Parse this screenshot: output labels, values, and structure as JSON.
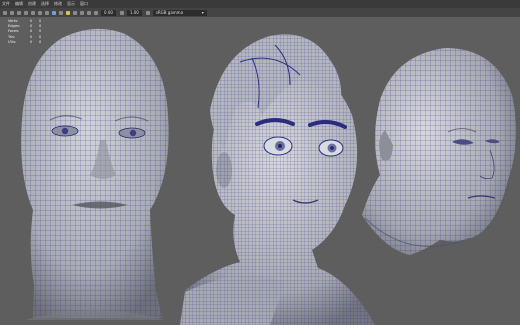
{
  "menubar": {
    "items": [
      "文件",
      "编辑",
      "创建",
      "选择",
      "修改",
      "显示",
      "窗口"
    ]
  },
  "toolbar": {
    "field_1": "0.00",
    "field_2": "1.00",
    "dropdown_value": "sRGB gamma",
    "dropdown_arrow": "▾"
  },
  "hud": {
    "rows": [
      {
        "label": "Verts:",
        "a": "0",
        "b": "0"
      },
      {
        "label": "Edges:",
        "a": "0",
        "b": "0"
      },
      {
        "label": "Faces:",
        "a": "0",
        "b": "0"
      },
      {
        "label": "Tris:",
        "a": "0",
        "b": "0"
      },
      {
        "label": "UVs:",
        "a": "0",
        "b": "0"
      }
    ]
  },
  "colors": {
    "viewport_bg": "#5e5e5e",
    "mesh_fill": "#b9bcc3",
    "wire_color": "#2e2f86",
    "menubar_bg": "#3a3a3a",
    "toolbar_bg": "#444444"
  },
  "icons": [
    "select-tool-icon",
    "move-tool-icon",
    "rotate-tool-icon",
    "scale-tool-icon",
    "camera-icon",
    "grid-icon",
    "wireframe-icon",
    "shaded-icon",
    "light-icon",
    "texture-icon"
  ]
}
